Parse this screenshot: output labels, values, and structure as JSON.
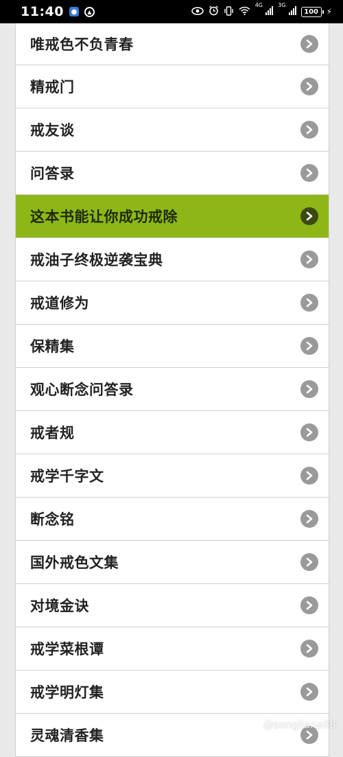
{
  "status_bar": {
    "time": "11:40",
    "battery": "100",
    "net1": "4G",
    "net2": "3G",
    "icons": [
      "app-icon",
      "hd-icon",
      "eye-icon",
      "alarm-icon",
      "vibrate-icon",
      "wifi-icon",
      "signal-icon",
      "battery-icon",
      "charging-icon"
    ]
  },
  "list": {
    "active_index": 4,
    "items": [
      {
        "label": "唯戒色不负青春"
      },
      {
        "label": "精戒门"
      },
      {
        "label": "戒友谈"
      },
      {
        "label": "问答录"
      },
      {
        "label": "这本书能让你成功戒除"
      },
      {
        "label": "戒油子终极逆袭宝典"
      },
      {
        "label": "戒道修为"
      },
      {
        "label": "保精集"
      },
      {
        "label": "观心断念问答录"
      },
      {
        "label": "戒者规"
      },
      {
        "label": "戒学千字文"
      },
      {
        "label": "断念铭"
      },
      {
        "label": "国外戒色文集"
      },
      {
        "label": "对境金诀"
      },
      {
        "label": "戒学菜根谭"
      },
      {
        "label": "戒学明灯集"
      },
      {
        "label": "灵魂清香集"
      }
    ]
  },
  "colors": {
    "active_bg": "#8db717",
    "chevron": "#9a9a9a",
    "chevron_active": "#3a4a12"
  },
  "watermark": "@songliana88"
}
